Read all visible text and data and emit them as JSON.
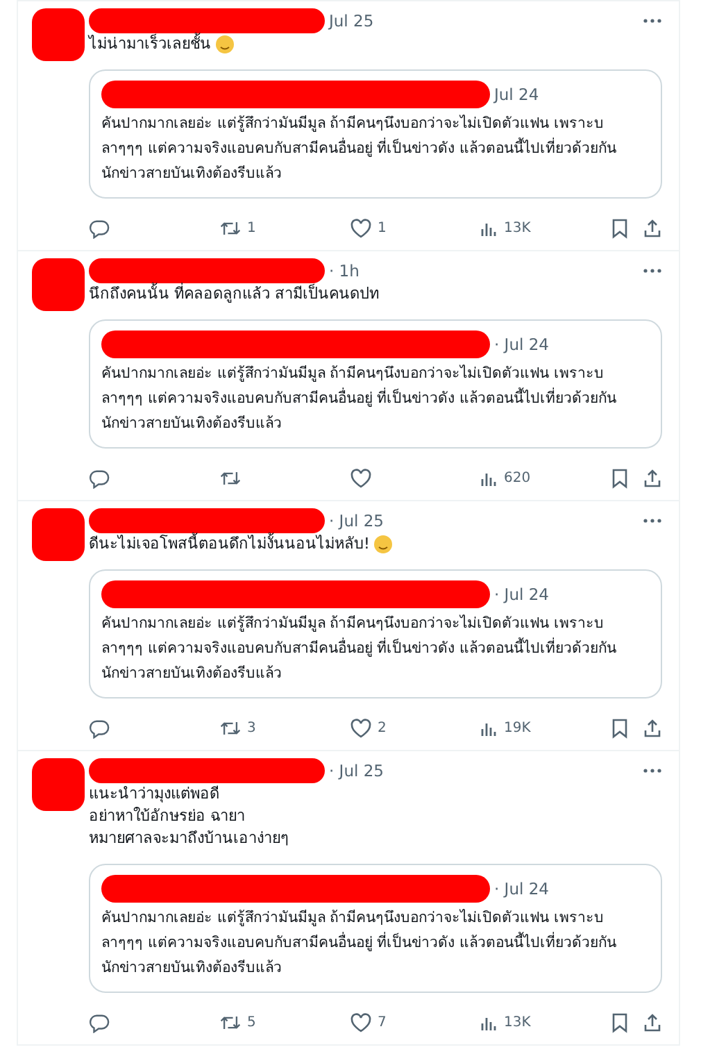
{
  "posts": [
    {
      "time": "Jul 25",
      "text": [
        "ไม่น่ามาเร็วเลยชั้น"
      ],
      "emoji": true,
      "quote": {
        "time": "Jul 24",
        "text": "คันปากมากเลยอ่ะ แต่รู้สึกว่ามันมีมูล ถ้ามีคนๆนึงบอกว่าจะไม่เปิดตัวแฟน เพราะบลาๆๆๆ แต่ความจริงแอบคบกับสามีคนอื่นอยู่ ที่เป็นข่าวดัง แล้วตอนนี้ไปเที่ยวด้วยกัน นักข่าวสายบันเทิงต้องรีบแล้ว"
      },
      "reposts": "1",
      "likes": "1",
      "views": "13K"
    },
    {
      "time": "· 1h",
      "text": [
        "นึกถึงคนนั้น ที่คลอดลูกแล้ว สามีเป็นคนดปท"
      ],
      "emoji": false,
      "quote": {
        "time": "· Jul 24",
        "text": "คันปากมากเลยอ่ะ แต่รู้สึกว่ามันมีมูล ถ้ามีคนๆนึงบอกว่าจะไม่เปิดตัวแฟน เพราะบลาๆๆๆ แต่ความจริงแอบคบกับสามีคนอื่นอยู่ ที่เป็นข่าวดัง แล้วตอนนี้ไปเที่ยวด้วยกัน นักข่าวสายบันเทิงต้องรีบแล้ว"
      },
      "views": "620"
    },
    {
      "time": "· Jul 25",
      "text": [
        "ดีนะไม่เจอโพสนี้ตอนดึกไม่งั้นนอนไม่หลับ!"
      ],
      "emoji": true,
      "quote": {
        "time": "· Jul 24",
        "text": "คันปากมากเลยอ่ะ แต่รู้สึกว่ามันมีมูล ถ้ามีคนๆนึงบอกว่าจะไม่เปิดตัวแฟน เพราะบลาๆๆๆ แต่ความจริงแอบคบกับสามีคนอื่นอยู่ ที่เป็นข่าวดัง แล้วตอนนี้ไปเที่ยวด้วยกัน นักข่าวสายบันเทิงต้องรีบแล้ว"
      },
      "reposts": "3",
      "likes": "2",
      "views": "19K"
    },
    {
      "time": "· Jul 25",
      "text": [
        "แนะนำว่ามุงแต่พอดี",
        "อย่าหาใบ้อักษรย่อ ฉายา",
        "หมายศาลจะมาถึงบ้านเอาง่ายๆ"
      ],
      "emoji": false,
      "quote": {
        "time": "· Jul 24",
        "text": "คันปากมากเลยอ่ะ แต่รู้สึกว่ามันมีมูล ถ้ามีคนๆนึงบอกว่าจะไม่เปิดตัวแฟน เพราะบลาๆๆๆ แต่ความจริงแอบคบกับสามีคนอื่นอยู่ ที่เป็นข่าวดัง แล้วตอนนี้ไปเที่ยวด้วยกัน นักข่าวสายบันเทิงต้องรีบแล้ว"
      },
      "reposts": "5",
      "likes": "7",
      "views": "13K"
    }
  ]
}
